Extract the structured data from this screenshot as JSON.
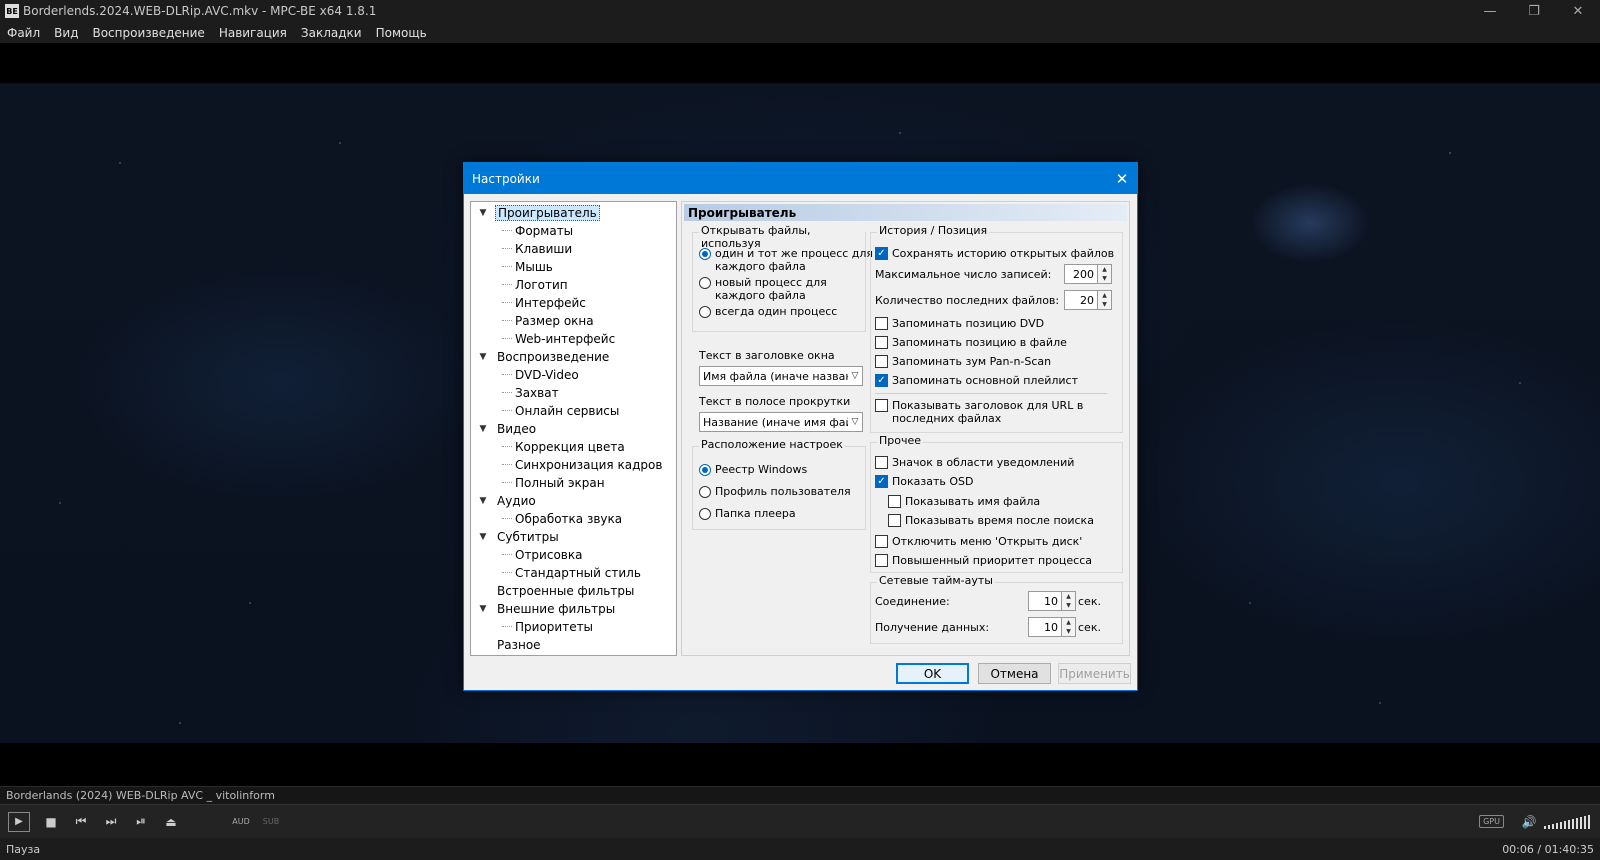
{
  "window": {
    "title": "Borderlends.2024.WEB-DLRip.AVC.mkv - MPC-BE x64 1.8.1",
    "icon_text": "BE",
    "controls": [
      "—",
      "❐",
      "✕"
    ]
  },
  "menu": [
    "Файл",
    "Вид",
    "Воспроизведение",
    "Навигация",
    "Закладки",
    "Помощь"
  ],
  "player": {
    "info": "Borderlands (2024) WEB-DLRip AVC _ vitolinform",
    "aud": "AUD",
    "sub": "SUB",
    "gpu": "GPU",
    "status": "Пауза",
    "time": "00:06 / 01:40:35",
    "volume_level": 1.0
  },
  "dialog": {
    "title": "Настройки",
    "tree": [
      {
        "label": "Проигрыватель",
        "level": 0,
        "expanded": true,
        "selected": true
      },
      {
        "label": "Форматы",
        "level": 1
      },
      {
        "label": "Клавиши",
        "level": 1
      },
      {
        "label": "Мышь",
        "level": 1
      },
      {
        "label": "Логотип",
        "level": 1
      },
      {
        "label": "Интерфейс",
        "level": 1
      },
      {
        "label": "Размер окна",
        "level": 1
      },
      {
        "label": "Web-интерфейс",
        "level": 1
      },
      {
        "label": "Воспроизведение",
        "level": 0,
        "expanded": true
      },
      {
        "label": "DVD-Video",
        "level": 1
      },
      {
        "label": "Захват",
        "level": 1
      },
      {
        "label": "Онлайн сервисы",
        "level": 1
      },
      {
        "label": "Видео",
        "level": 0,
        "expanded": true
      },
      {
        "label": "Коррекция цвета",
        "level": 1
      },
      {
        "label": "Синхронизация кадров",
        "level": 1
      },
      {
        "label": "Полный экран",
        "level": 1
      },
      {
        "label": "Аудио",
        "level": 0,
        "expanded": true
      },
      {
        "label": "Обработка звука",
        "level": 1
      },
      {
        "label": "Субтитры",
        "level": 0,
        "expanded": true
      },
      {
        "label": "Отрисовка",
        "level": 1
      },
      {
        "label": "Стандартный стиль",
        "level": 1
      },
      {
        "label": "Встроенные фильтры",
        "level": 0,
        "leaf": true
      },
      {
        "label": "Внешние фильтры",
        "level": 0,
        "expanded": true
      },
      {
        "label": "Приоритеты",
        "level": 1
      },
      {
        "label": "Разное",
        "level": 0,
        "leaf": true
      }
    ],
    "panel_header": "Проигрыватель",
    "open_files": {
      "title": "Открывать файлы, используя",
      "options": [
        "один и тот же процесс для\nкаждого файла",
        "новый процесс для\nкаждого файла",
        "всегда один процесс"
      ],
      "selected": 0
    },
    "window_title_text": {
      "label": "Текст в заголовке окна",
      "value": "Имя файла (иначе название"
    },
    "seekbar_text": {
      "label": "Текст в полосе прокрутки",
      "value": "Название (иначе имя файла"
    },
    "settings_location": {
      "title": "Расположение настроек",
      "options": [
        "Реестр Windows",
        "Профиль пользователя",
        "Папка плеера"
      ],
      "selected": 0
    },
    "history": {
      "title": "История / Позиция",
      "save_history": {
        "label": "Сохранять историю открытых файлов",
        "checked": true
      },
      "max_records": {
        "label": "Максимальное число записей:",
        "value": "200"
      },
      "recent_count": {
        "label": "Количество последних файлов:",
        "value": "20"
      },
      "remember_dvd": {
        "label": "Запоминать позицию DVD",
        "checked": false
      },
      "remember_file": {
        "label": "Запоминать позицию в файле",
        "checked": false
      },
      "remember_zoom": {
        "label": "Запоминать зум Pan-n-Scan",
        "checked": false
      },
      "remember_playlist": {
        "label": "Запоминать основной плейлист",
        "checked": true
      },
      "show_url_title": {
        "label": "Показывать заголовок для URL в\nпоследних файлах",
        "checked": false
      }
    },
    "other": {
      "title": "Прочее",
      "tray_icon": {
        "label": "Значок в области уведомлений",
        "checked": false
      },
      "show_osd": {
        "label": "Показать OSD",
        "checked": true
      },
      "show_filename": {
        "label": "Показывать имя файла",
        "checked": false
      },
      "show_seek_time": {
        "label": "Показывать время после поиска",
        "checked": false
      },
      "disable_open_disc": {
        "label": "Отключить меню 'Открыть диск'",
        "checked": false
      },
      "high_priority": {
        "label": "Повышенный приоритет процесса",
        "checked": false
      }
    },
    "network": {
      "title": "Сетевые тайм-ауты",
      "connection": {
        "label": "Соединение:",
        "value": "10",
        "unit": "сек."
      },
      "receive": {
        "label": "Получение данных:",
        "value": "10",
        "unit": "сек."
      }
    },
    "buttons": {
      "ok": "OK",
      "cancel": "Отмена",
      "apply": "Применить"
    }
  }
}
